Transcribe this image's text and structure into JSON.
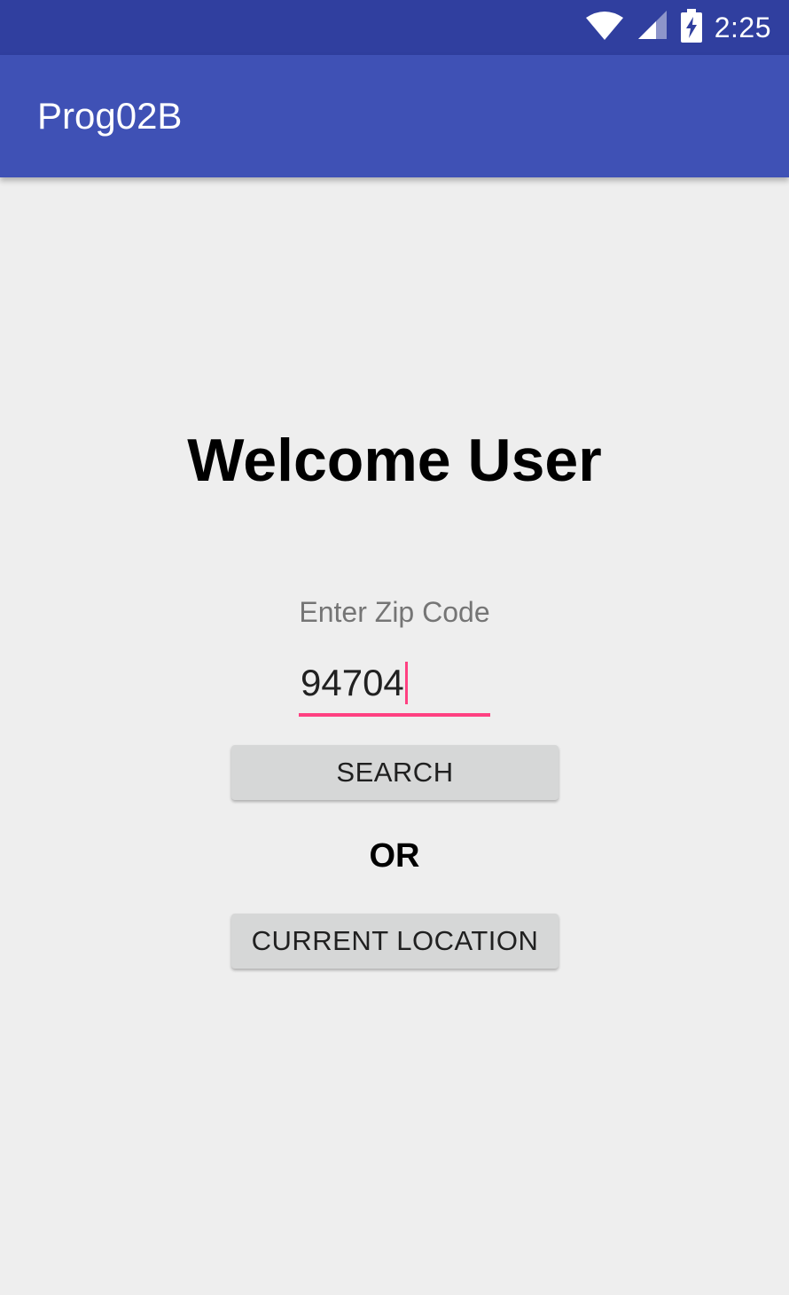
{
  "status_bar": {
    "time": "2:25",
    "icons": [
      "wifi-icon",
      "cell-signal-icon",
      "battery-charging-icon"
    ],
    "color": "#303f9f"
  },
  "app_bar": {
    "title": "Prog02B",
    "color": "#3f51b5"
  },
  "main": {
    "heading": "Welcome User",
    "zip_label": "Enter Zip Code",
    "zip_value": "94704",
    "search_label": "SEARCH",
    "or_text": "OR",
    "location_label": "CURRENT LOCATION",
    "accent_color": "#ff4081"
  }
}
